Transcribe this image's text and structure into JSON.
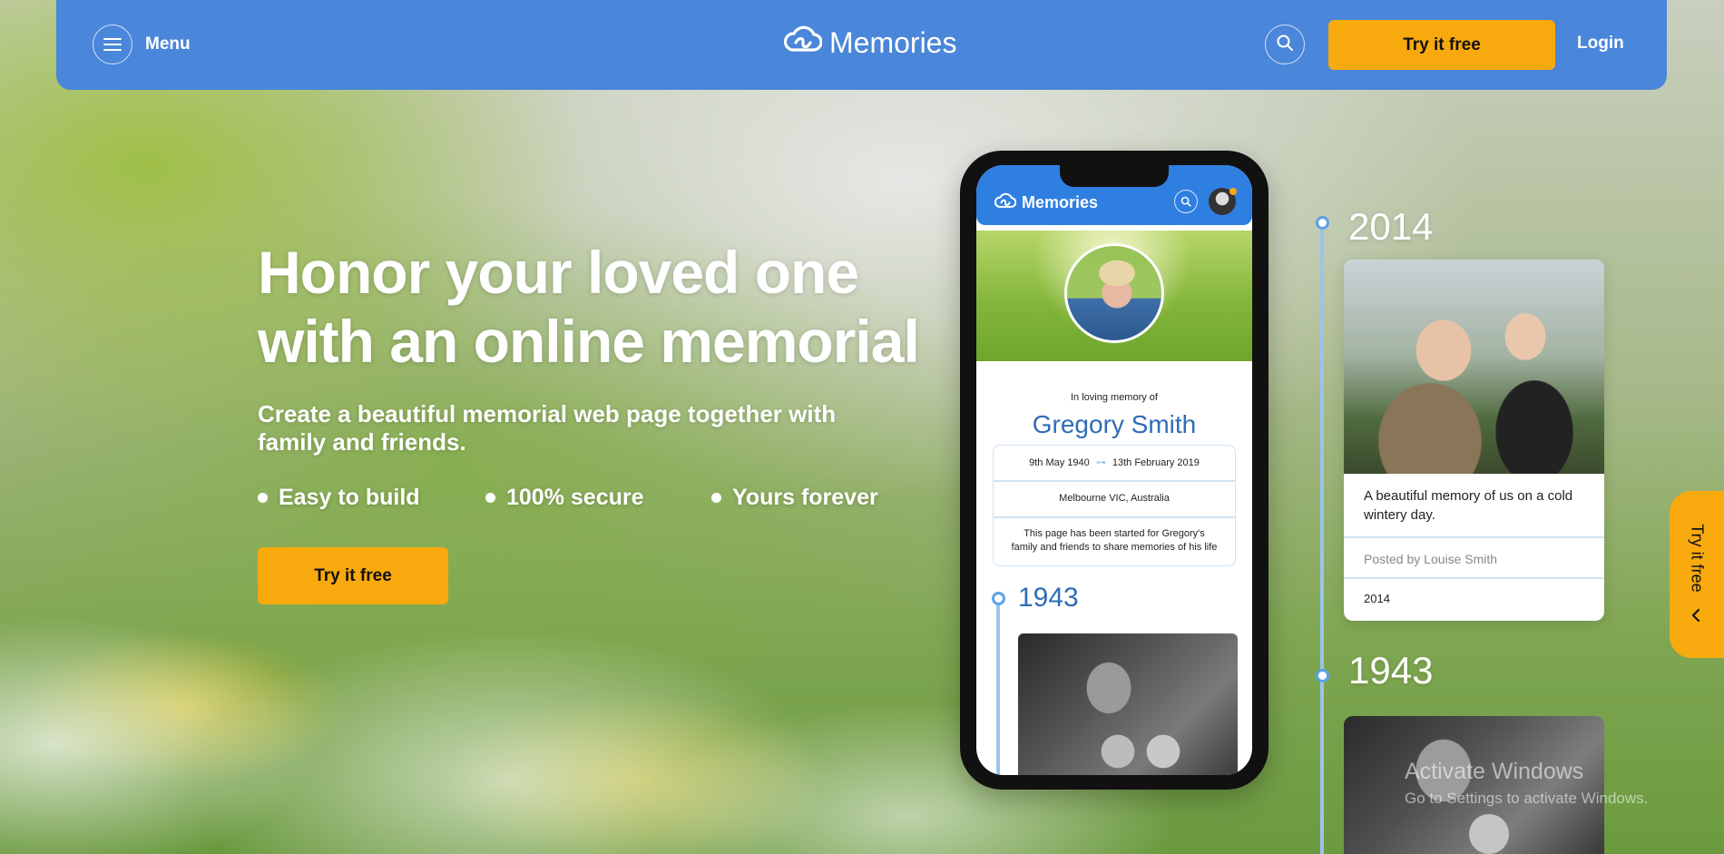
{
  "header": {
    "menu_label": "Menu",
    "brand": "Memories",
    "cta_label": "Try it free",
    "login_label": "Login"
  },
  "hero": {
    "headline_line1": "Honor your loved one",
    "headline_line2": "with an online memorial",
    "subheadline": "Create a beautiful memorial web page together with family and friends.",
    "features": [
      "Easy to build",
      "100% secure",
      "Yours forever"
    ],
    "cta_label": "Try it free"
  },
  "phone": {
    "brand": "Memories",
    "in_memory_label": "In loving memory of",
    "name": "Gregory Smith",
    "born": "9th May 1940",
    "died": "13th February 2019",
    "location": "Melbourne VIC, Australia",
    "description": "This page has been started for Gregory's family and friends to share memories of his life",
    "timeline_year": "1943"
  },
  "timeline": {
    "entries": [
      {
        "year": "2014",
        "caption": "A beautiful memory of us on a cold wintery day.",
        "posted_by": "Posted by Louise Smith",
        "tag_year": "2014"
      },
      {
        "year": "1943"
      }
    ]
  },
  "side_tab": {
    "label": "Try it free"
  },
  "watermark": {
    "title": "Activate Windows",
    "subtitle": "Go to Settings to activate Windows."
  },
  "colors": {
    "header_blue": "#4a86d9",
    "accent_orange": "#f8a90d",
    "phone_blue": "#2f7fe0",
    "timeline_blue": "#9cc3ec"
  },
  "icons": [
    "menu-icon",
    "cloud-logo-icon",
    "search-icon",
    "chevron-left-icon"
  ]
}
